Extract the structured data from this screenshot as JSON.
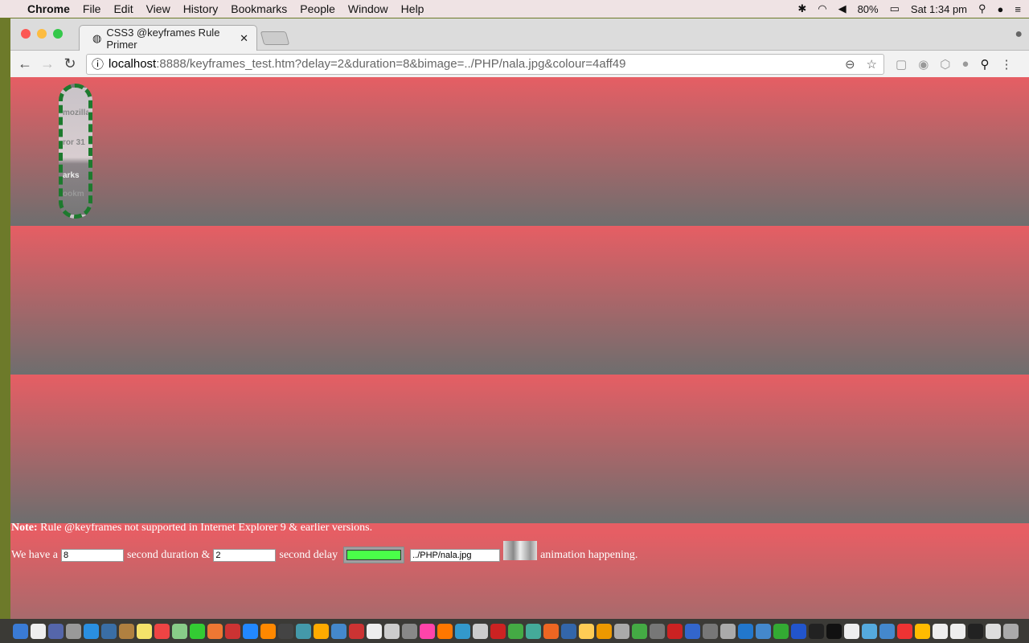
{
  "menubar": {
    "app": "Chrome",
    "items": [
      "File",
      "Edit",
      "View",
      "History",
      "Bookmarks",
      "People",
      "Window",
      "Help"
    ],
    "battery": "80%",
    "clock": "Sat 1:34 pm"
  },
  "browser": {
    "tab_title": "CSS3 @keyframes Rule Primer",
    "url_host": "localhost",
    "url_path": ":8888/keyframes_test.htm?delay=2&duration=8&bimage=../PHP/nala.jpg&colour=4aff49"
  },
  "page": {
    "note_label": "Note:",
    "note_text": " Rule @keyframes not supported in Internet Explorer 9 & earlier versions.",
    "text1": "We have a",
    "duration": "8",
    "text2": "second duration &",
    "delay": "2",
    "text3": "second delay",
    "colour": "#4aff49",
    "bimage": "../PHP/nala.jpg",
    "text4": "animation happening.",
    "anim_texts": [
      "mozilla",
      "ror 31",
      "arks",
      "ookm"
    ]
  },
  "colors": {
    "band_top": "#e65e64",
    "band_bottom": "#6e6e6e",
    "dash": "#1d7a2e"
  }
}
